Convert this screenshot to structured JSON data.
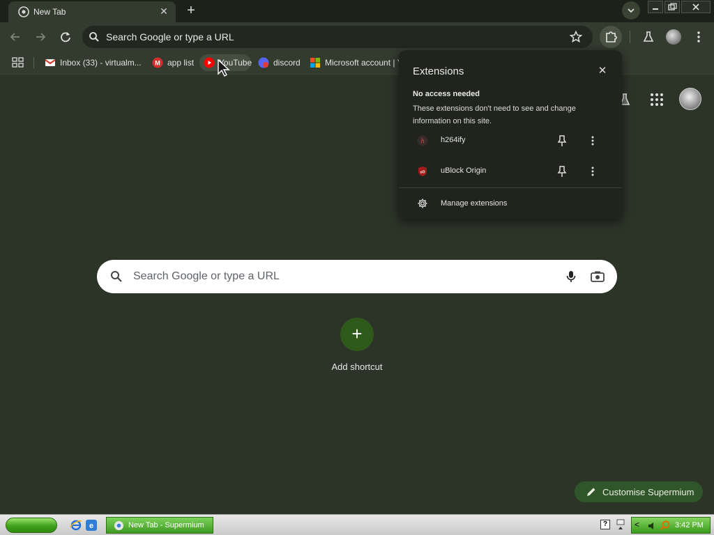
{
  "tab": {
    "title": "New Tab",
    "close": "✕"
  },
  "toolbar": {
    "omnibox_placeholder": "Search Google or type a URL"
  },
  "bookmarks": [
    {
      "label": "Inbox (33) - virtualm...",
      "icon": "gmail-icon"
    },
    {
      "label": "app list",
      "icon": "m-icon"
    },
    {
      "label": "YouTube",
      "icon": "youtube-icon"
    },
    {
      "label": "discord",
      "icon": "discord-icon"
    },
    {
      "label": "Microsoft account | Y...",
      "icon": "microsoft-icon"
    }
  ],
  "ntp": {
    "search_placeholder": "Search Google or type a URL",
    "add_shortcut": "Add shortcut",
    "add_symbol": "+",
    "customise": "Customise Supermium"
  },
  "extensions": {
    "title": "Extensions",
    "close": "✕",
    "section_title": "No access needed",
    "section_desc": "These extensions don't need to see and change information on this site.",
    "items": [
      {
        "name": "h264ify",
        "icon": "h264ify-icon"
      },
      {
        "name": "uBlock Origin",
        "icon": "ublock-origin-icon"
      }
    ],
    "manage": "Manage extensions"
  },
  "taskbar": {
    "task_label": "New Tab - Supermium",
    "clock": "3:42 PM",
    "help": "?"
  },
  "colors": {
    "page_bg": "#2c3327",
    "toolbar_bg": "#333a2e",
    "popup_bg": "#20241d",
    "accent_green": "#2e5a1c"
  }
}
